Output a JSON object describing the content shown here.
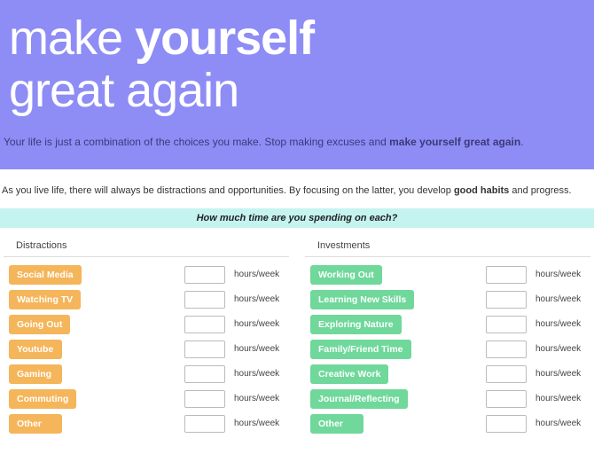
{
  "hero": {
    "word1": "make",
    "word2": "yourself",
    "word3": "great again"
  },
  "tagline": {
    "pre": "Your life is just a combination of the choices you make. Stop making excuses and ",
    "emph": "make yourself great again",
    "post": "."
  },
  "intro": {
    "pre": "As you live life, there will always be distractions and opportunities. By focusing on the latter, you develop ",
    "emph": "good habits",
    "post": " and progress."
  },
  "question": "How much time are you spending on each?",
  "unit_label": "hours/week",
  "columns": {
    "left": {
      "header": "Distractions",
      "items": [
        "Social Media",
        "Watching TV",
        "Going Out",
        "Youtube",
        "Gaming",
        "Commuting",
        "Other"
      ]
    },
    "right": {
      "header": "Investments",
      "items": [
        "Working Out",
        "Learning New Skills",
        "Exploring Nature",
        "Family/Friend Time",
        "Creative Work",
        "Journal/Reflecting",
        "Other"
      ]
    }
  }
}
